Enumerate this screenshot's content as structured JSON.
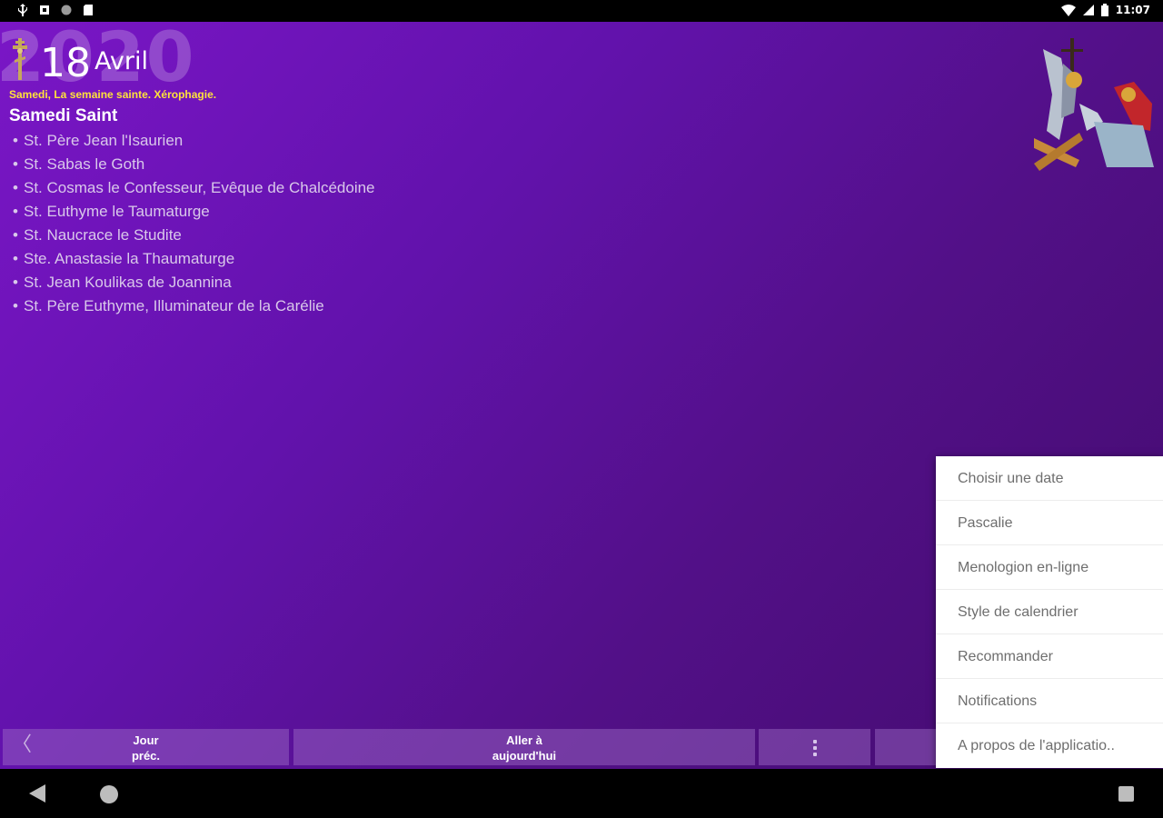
{
  "status_bar": {
    "time": "11:07",
    "left_icons": [
      "usb-icon",
      "notification-icon",
      "sync-icon",
      "sd-card-icon"
    ],
    "right_icons": [
      "wifi-icon",
      "cellular-icon",
      "battery-icon"
    ]
  },
  "date_header": {
    "year": "2020",
    "day": "18",
    "month": "Avril",
    "subtitle": "Samedi, La semaine sainte. Xérophagie."
  },
  "feast": {
    "title": "Samedi Saint"
  },
  "saints": [
    "St. Père Jean l'Isaurien",
    "St. Sabas le Goth",
    "St. Cosmas le Confesseur, Evêque de Chalcédoine",
    "St. Euthyme le Taumaturge",
    "St. Naucrace le Studite",
    "Ste. Anastasie la Thaumaturge",
    "St. Jean Koulikas de Joannina",
    "St. Père Euthyme, Illuminateur de la Carélie"
  ],
  "bottom_bar": {
    "prev_line1": "Jour",
    "prev_line2": "préc.",
    "today_line1": "Aller à",
    "today_line2": "aujourd'hui"
  },
  "menu": {
    "items": [
      "Choisir une date",
      "Pascalie",
      "Menologion en-ligne",
      "Style de calendrier",
      "Recommander",
      "Notifications",
      "A propos de l'applicatio.."
    ]
  },
  "colors": {
    "background_start": "#7a16c6",
    "background_end": "#430b6e",
    "subtitle": "#ffe23a",
    "saint_text": "#d9c8ea",
    "menu_text": "#6e6e6e"
  }
}
